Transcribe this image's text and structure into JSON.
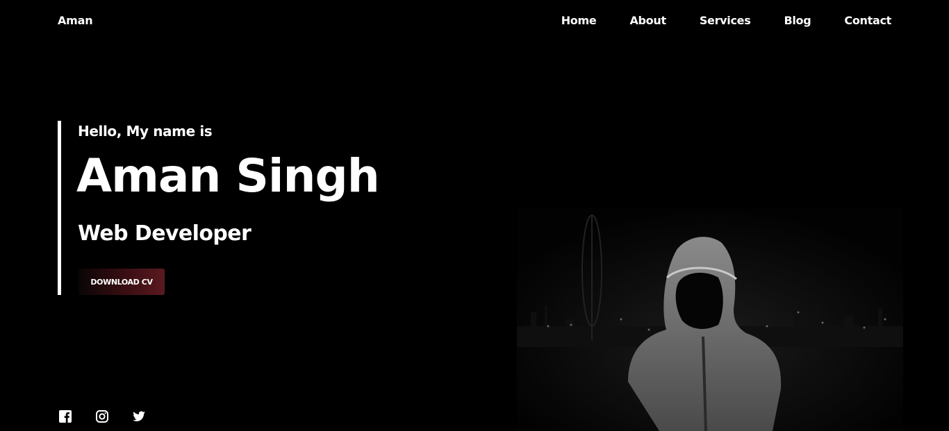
{
  "brand": {
    "name": "Aman"
  },
  "nav": {
    "items": [
      {
        "label": "Home"
      },
      {
        "label": "About"
      },
      {
        "label": "Services"
      },
      {
        "label": "Blog"
      },
      {
        "label": "Contact"
      }
    ]
  },
  "hero": {
    "greeting": "Hello, My name is",
    "name": "Aman Singh",
    "role": "Web Developer",
    "cta_label": "DOWNLOAD CV"
  },
  "social": {
    "icons": [
      "facebook-icon",
      "instagram-icon",
      "twitter-icon"
    ]
  },
  "colors": {
    "background": "#000000",
    "text": "#ffffff",
    "button_accent": "#5a1a1f"
  }
}
